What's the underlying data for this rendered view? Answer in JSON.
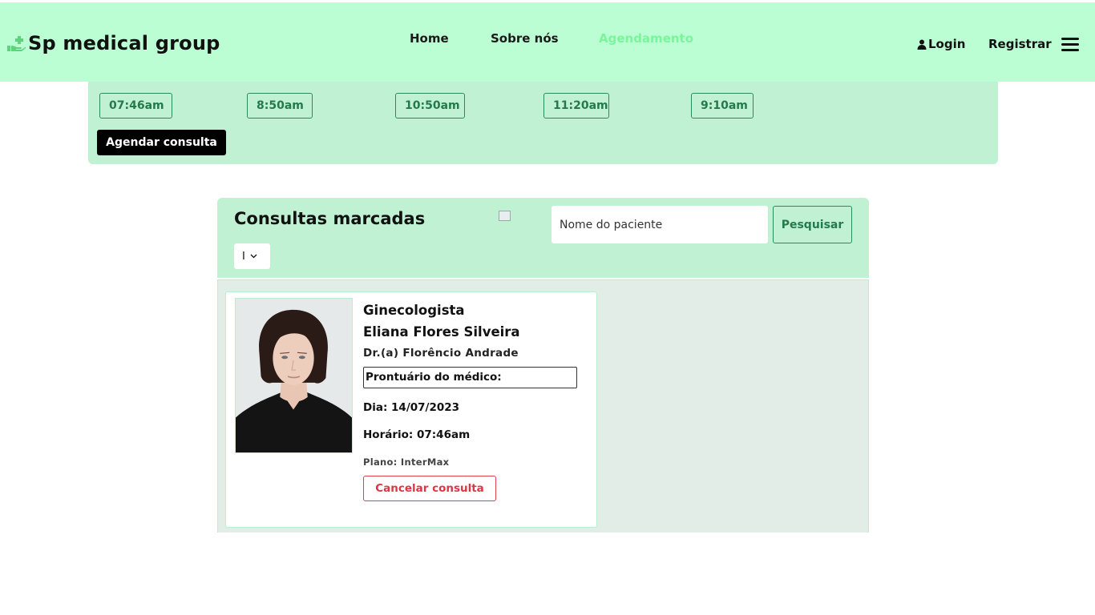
{
  "colors": {
    "nav_bg": "#bcfed3",
    "panel_bg": "#c0f1d3",
    "list_bg": "#e3ede8",
    "accent_green": "#237a4a",
    "active_link": "#7bf59c",
    "danger": "#dc3545"
  },
  "nav": {
    "brand": "Sp medical group",
    "brand_icon": "hand-holding-medical-icon",
    "links": [
      "Home",
      "Sobre nós",
      "Agendamento"
    ],
    "active_link": "Agendamento",
    "login": "Login",
    "login_icon": "user-icon",
    "registrar": "Registrar",
    "menu_icon": "hamburger-menu-icon"
  },
  "schedule": {
    "times": [
      "07:46am",
      "8:50am",
      "10:50am",
      "11:20am",
      "9:10am"
    ],
    "agendar_label": "Agendar consulta"
  },
  "consultas": {
    "title": "Consultas marcadas",
    "search_placeholder": "Nome do paciente",
    "search_button": "Pesquisar",
    "filter_value": "I",
    "cards": [
      {
        "especialidade": "Ginecologista",
        "paciente": "Eliana Flores Silveira",
        "medico": "Dr.(a) Florêncio Andrade",
        "prontuario": "Prontuário do médico:",
        "dia": "Dia: 14/07/2023",
        "horario": "Horário: 07:46am",
        "plano": "Plano: InterMax",
        "cancel_label": "Cancelar consulta"
      }
    ]
  }
}
